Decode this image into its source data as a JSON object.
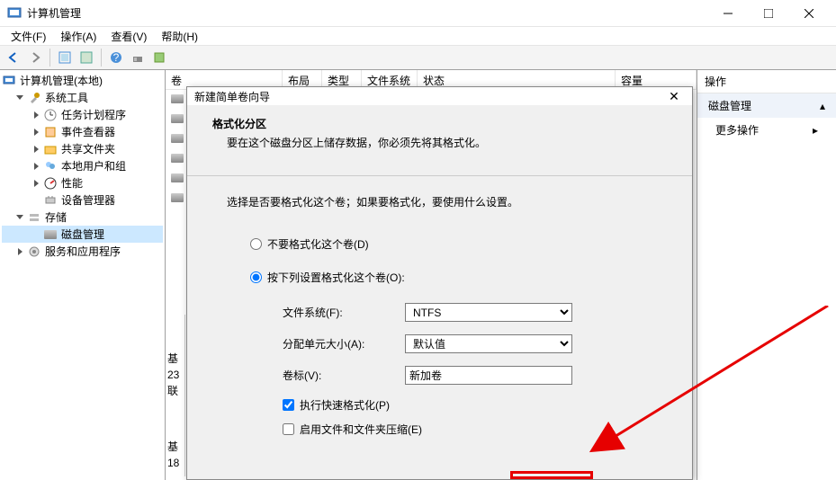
{
  "window": {
    "title": "计算机管理"
  },
  "menu": {
    "file": "文件(F)",
    "action": "操作(A)",
    "view": "查看(V)",
    "help": "帮助(H)"
  },
  "tree": {
    "root": "计算机管理(本地)",
    "tools": "系统工具",
    "schedule": "任务计划程序",
    "eventviewer": "事件查看器",
    "sharedfolders": "共享文件夹",
    "localusers": "本地用户和组",
    "performance": "性能",
    "devicemgr": "设备管理器",
    "storage": "存储",
    "diskmgmt": "磁盘管理",
    "services": "服务和应用程序"
  },
  "columns": {
    "volume": "卷",
    "layout": "布局",
    "type": "类型",
    "filesystem": "文件系统",
    "status": "状态",
    "capacity": "容量"
  },
  "actions": {
    "header": "操作",
    "diskmgmt": "磁盘管理",
    "more": "更多操作"
  },
  "dialog": {
    "title": "新建简单卷向导",
    "heading": "格式化分区",
    "desc": "要在这个磁盘分区上储存数据，你必须先将其格式化。",
    "instruction": "选择是否要格式化这个卷；如果要格式化，要使用什么设置。",
    "radio_no": "不要格式化这个卷(D)",
    "radio_yes": "按下列设置格式化这个卷(O):",
    "fs_label": "文件系统(F):",
    "fs_value": "NTFS",
    "alloc_label": "分配单元大小(A):",
    "alloc_value": "默认值",
    "vol_label": "卷标(V):",
    "vol_value": "新加卷",
    "quick_format": "执行快速格式化(P)",
    "compress": "启用文件和文件夹压缩(E)"
  },
  "bottom": {
    "basic": "基",
    "size1": "23",
    "online": "联",
    "basic2": "基",
    "size2": "18"
  }
}
